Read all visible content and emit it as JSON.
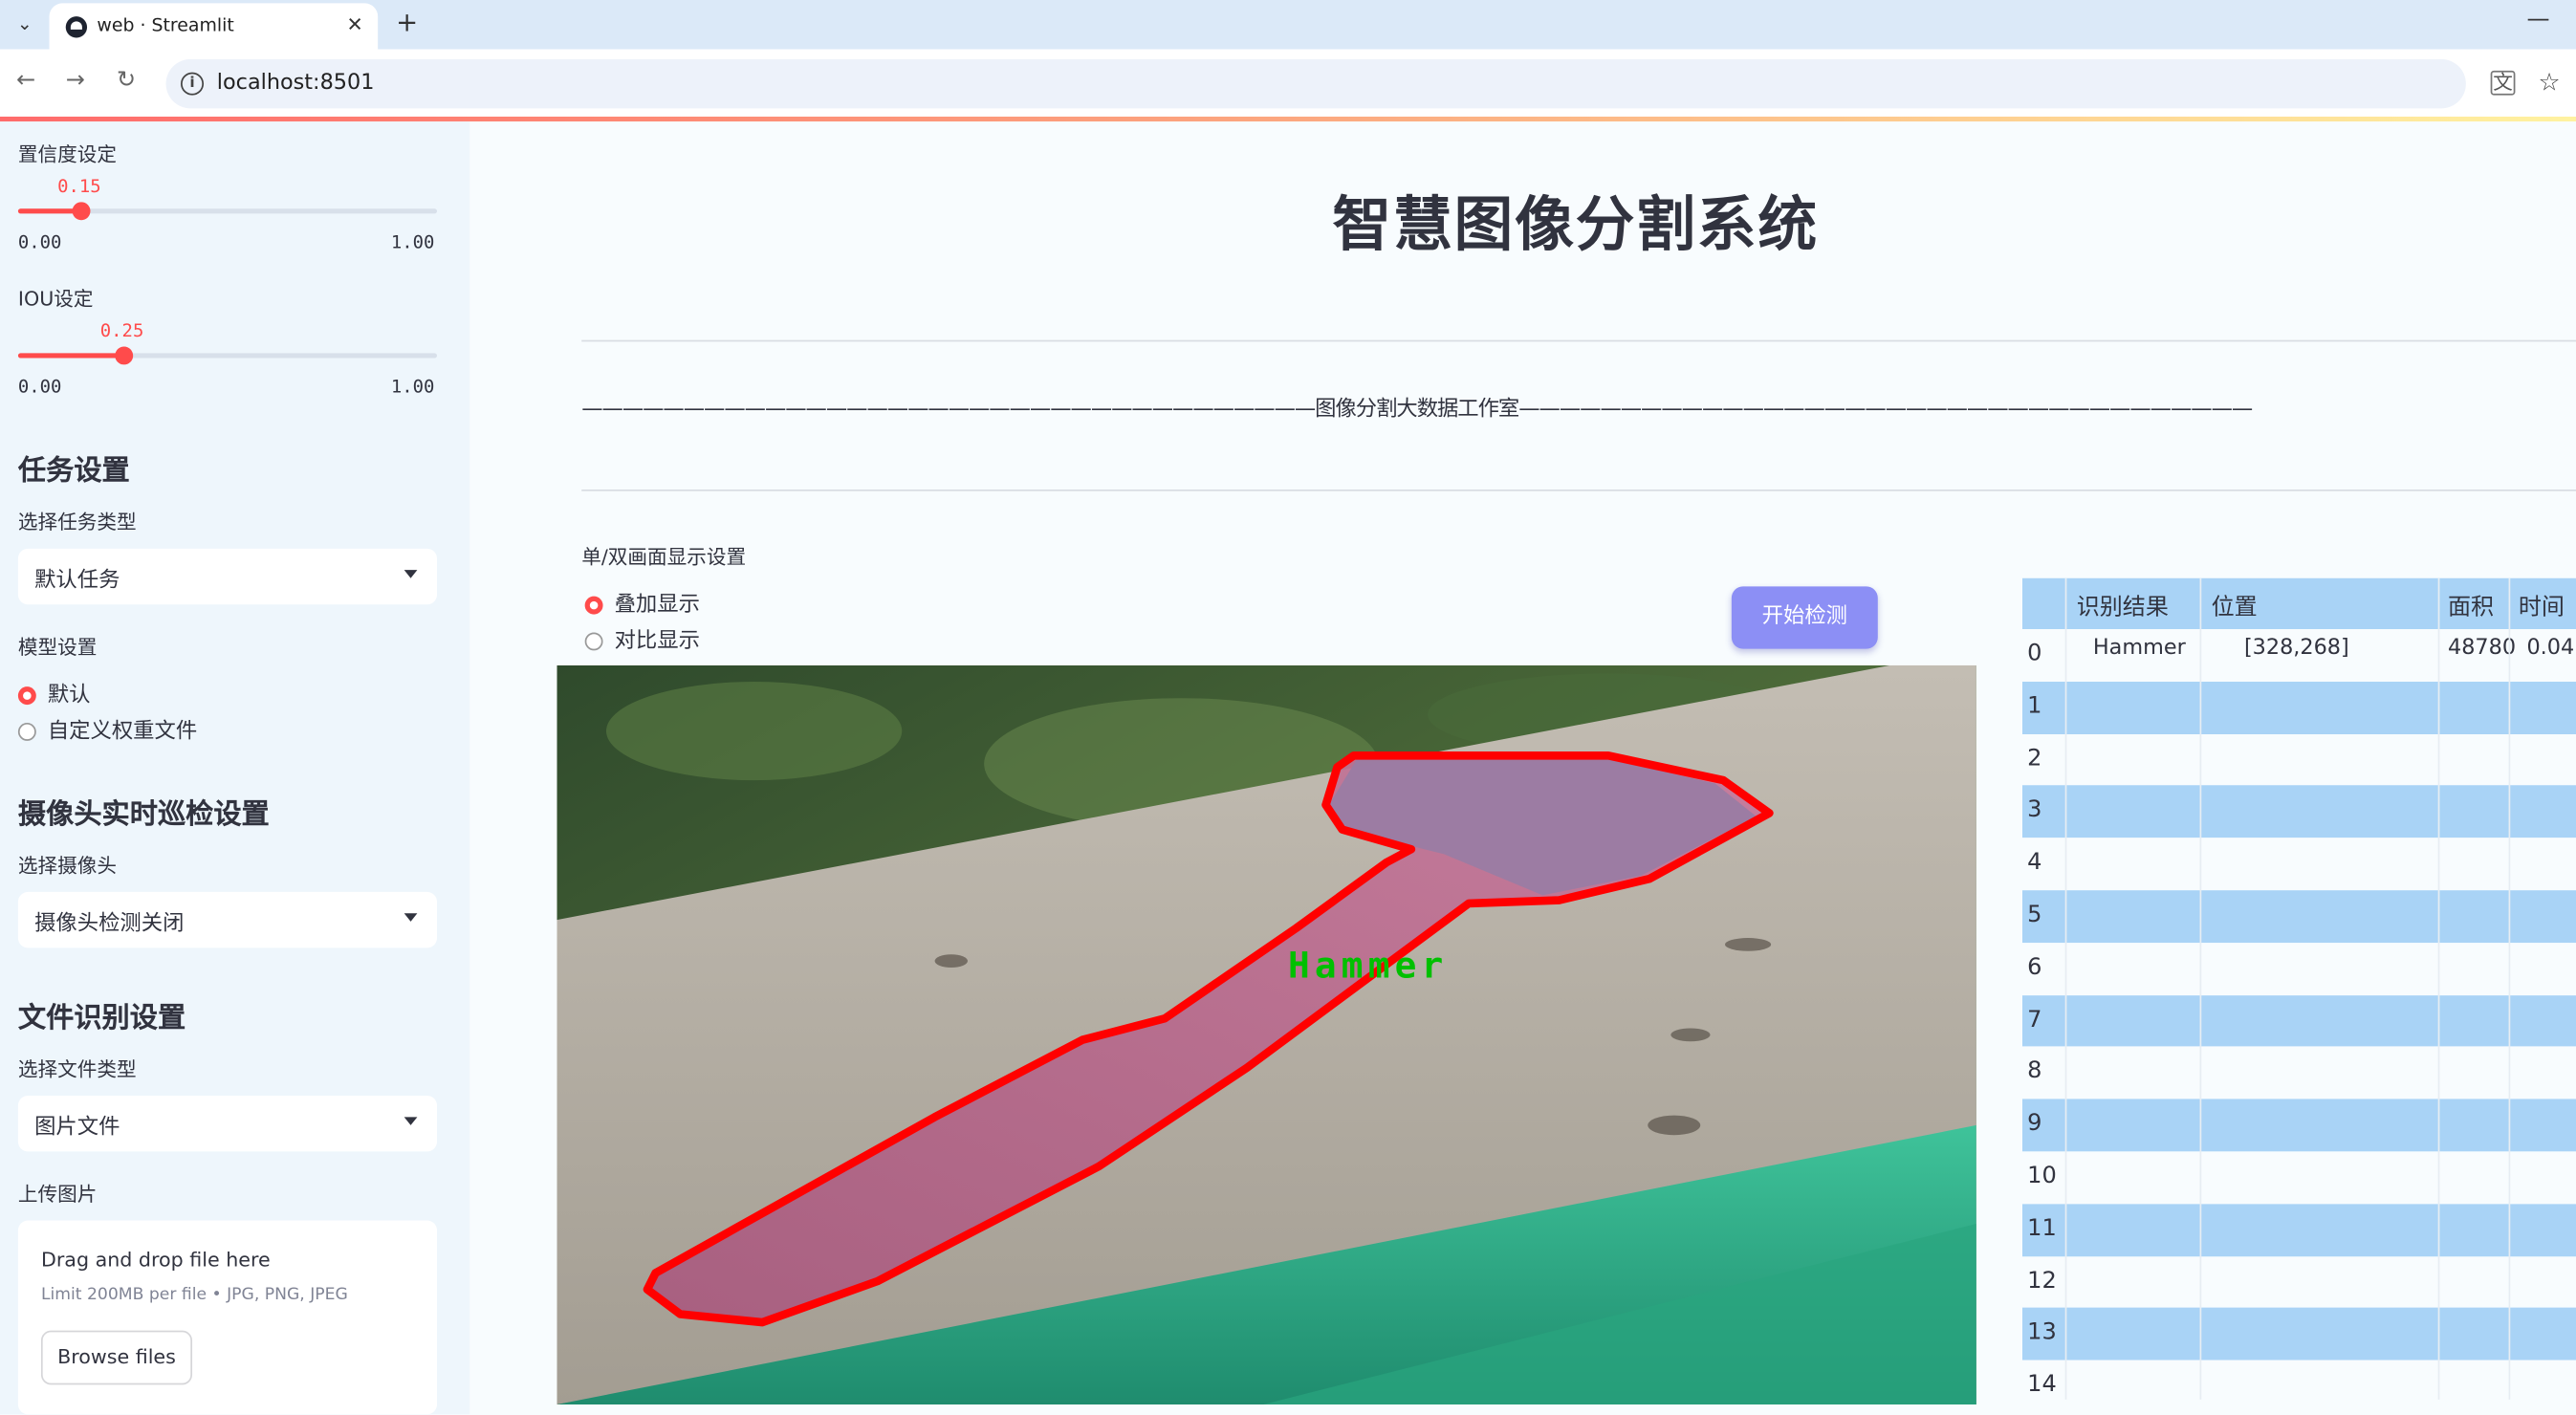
{
  "browser": {
    "tab_title": "web · Streamlit",
    "url": "localhost:8501"
  },
  "sidebar": {
    "confidence": {
      "label": "置信度设定",
      "value": "0.15",
      "fraction": 0.15,
      "min": "0.00",
      "max": "1.00"
    },
    "iou": {
      "label": "IOU设定",
      "value": "0.25",
      "fraction": 0.25,
      "min": "0.00",
      "max": "1.00"
    },
    "task_settings": {
      "heading": "任务设置",
      "task_type_label": "选择任务类型",
      "task_type_value": "默认任务",
      "model_label": "模型设置",
      "model_options": [
        "默认",
        "自定义权重文件"
      ],
      "model_selected": 0
    },
    "camera_settings": {
      "heading": "摄像头实时巡检设置",
      "camera_label": "选择摄像头",
      "camera_value": "摄像头检测关闭"
    },
    "file_settings": {
      "heading": "文件识别设置",
      "file_type_label": "选择文件类型",
      "file_type_value": "图片文件",
      "upload_label": "上传图片",
      "drop_text": "Drag and drop file here",
      "limit_text": "Limit 200MB per file • JPG, PNG, JPEG",
      "browse_label": "Browse files"
    }
  },
  "main": {
    "title": "智慧图像分割系统",
    "banner": "————————————————————————————————————图像分割大数据工作室————————————————————————————————————",
    "display_mode_label": "单/双画面显示设置",
    "display_options": [
      "叠加显示",
      "对比显示"
    ],
    "display_selected": 0,
    "start_button": "开始检测",
    "detection_label": "Hammer"
  },
  "results_table": {
    "columns": [
      "识别结果",
      "位置",
      "面积",
      "时间"
    ],
    "rows": [
      {
        "index": "0",
        "result": "Hammer",
        "position": "[328,268]",
        "area": "48780",
        "time": "0.04"
      },
      {
        "index": "1"
      },
      {
        "index": "2"
      },
      {
        "index": "3"
      },
      {
        "index": "4"
      },
      {
        "index": "5"
      },
      {
        "index": "6"
      },
      {
        "index": "7"
      },
      {
        "index": "8"
      },
      {
        "index": "9"
      },
      {
        "index": "10"
      },
      {
        "index": "11"
      },
      {
        "index": "12"
      },
      {
        "index": "13"
      },
      {
        "index": "14"
      }
    ]
  },
  "colors": {
    "accent": "#ff4b4b",
    "button": "#8c8ff5",
    "table_stripe": "#a9d3f6",
    "sidebar_bg": "#eef6fc",
    "mask_outline": "#ff0000",
    "label_text": "#00c000"
  }
}
